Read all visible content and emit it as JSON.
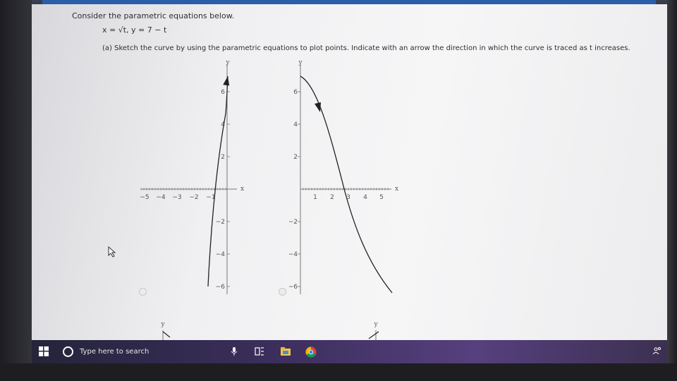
{
  "question": {
    "intro": "Consider the parametric equations below.",
    "equations": "x = √t,   y = 7 − t",
    "part_a": "(a) Sketch the curve by using the parametric equations to plot points. Indicate with an arrow the direction in which the curve is traced as t increases."
  },
  "graphs": [
    {
      "xlabel": "x",
      "ylabel": "y",
      "x_ticks": [
        "−5",
        "−4",
        "−3",
        "−2",
        "−1"
      ],
      "y_ticks": [
        "6",
        "4",
        "2",
        "−2",
        "−4",
        "−6"
      ],
      "arrow_direction": "upward"
    },
    {
      "xlabel": "x",
      "ylabel": "y",
      "x_ticks": [
        "1",
        "2",
        "3",
        "4",
        "5"
      ],
      "y_ticks": [
        "6",
        "4",
        "2",
        "−2",
        "−4",
        "−6"
      ],
      "arrow_direction": "downward"
    }
  ],
  "partial_graphs": [
    {
      "ylabel": "y"
    },
    {
      "ylabel": "y"
    }
  ],
  "taskbar": {
    "search_placeholder": "Type here to search",
    "icons": [
      "windows-start-icon",
      "cortana-icon",
      "microphone-icon",
      "task-view-icon",
      "file-explorer-icon",
      "chrome-icon"
    ]
  },
  "colors": {
    "taskbar_start": "#24243a",
    "taskbar_end": "#56407e",
    "screen_bg": "#f0f0f2",
    "curve": "#222222"
  }
}
